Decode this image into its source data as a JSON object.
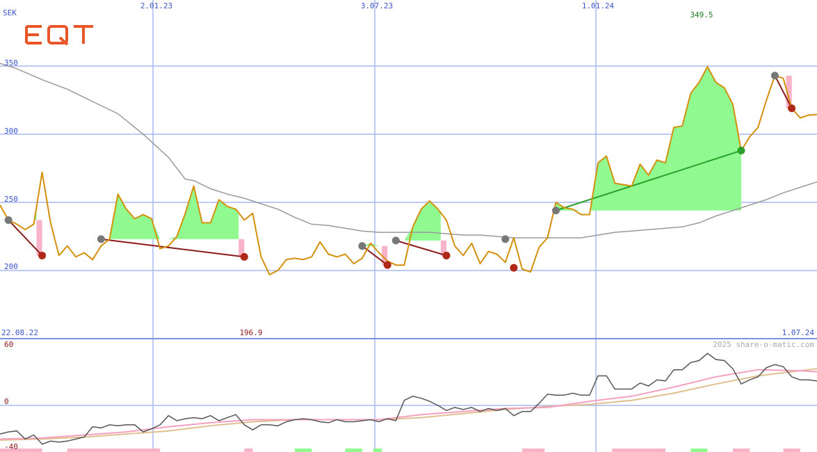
{
  "logo": {
    "text": "EQT",
    "color": "#e8562a"
  },
  "currency": "SEK",
  "watermark": "2025 share-o-matic.com",
  "colors": {
    "price": "#d4900a",
    "sma": "#999999",
    "gain_fill": "#90fa90",
    "loss_fill": "#f9b3c8",
    "gridline": "#a8b8f0",
    "axis_line": "#8090e0",
    "peak_marker": "#777777",
    "trough_marker": "#b02818",
    "trend_down": "#8b1a1a",
    "trend_up": "#2aa02a",
    "osc_main": "#555555",
    "osc_pink": "#f4a0c0",
    "osc_tan": "#e0c090"
  },
  "chart_data": [
    {
      "type": "line",
      "name": "price-panel",
      "unit": "SEK",
      "ylim": [
        165,
        360
      ],
      "yticks": [
        "350",
        "300",
        "250",
        "200"
      ],
      "x_start_label": "22.08.22",
      "x_end_label": "1.07.24",
      "top_date_labels": [
        "2.01.23",
        "3.07.23",
        "1.01.24"
      ],
      "high_label": "349.5",
      "low_label": "196.9",
      "price": [
        [
          0,
          248
        ],
        [
          3,
          237
        ],
        [
          6,
          234
        ],
        [
          9,
          230
        ],
        [
          12,
          234
        ],
        [
          15,
          272
        ],
        [
          18,
          235
        ],
        [
          21,
          211
        ],
        [
          24,
          218
        ],
        [
          27,
          210
        ],
        [
          30,
          213
        ],
        [
          33,
          208
        ],
        [
          36,
          218
        ],
        [
          39,
          223
        ],
        [
          42,
          256
        ],
        [
          45,
          245
        ],
        [
          48,
          238
        ],
        [
          51,
          241
        ],
        [
          54,
          238
        ],
        [
          57,
          216
        ],
        [
          60,
          218
        ],
        [
          63,
          225
        ],
        [
          66,
          242
        ],
        [
          69,
          262
        ],
        [
          72,
          235
        ],
        [
          75,
          235
        ],
        [
          78,
          252
        ],
        [
          81,
          247
        ],
        [
          84,
          245
        ],
        [
          87,
          237
        ],
        [
          90,
          242
        ],
        [
          93,
          210
        ],
        [
          96,
          197
        ],
        [
          99,
          200
        ],
        [
          102,
          208
        ],
        [
          105,
          209
        ],
        [
          108,
          208
        ],
        [
          111,
          210
        ],
        [
          114,
          221
        ],
        [
          117,
          212
        ],
        [
          120,
          210
        ],
        [
          123,
          212
        ],
        [
          126,
          205
        ],
        [
          129,
          209
        ],
        [
          132,
          220
        ],
        [
          135,
          213
        ],
        [
          138,
          207
        ],
        [
          141,
          204
        ],
        [
          144,
          204
        ],
        [
          147,
          232
        ],
        [
          150,
          245
        ],
        [
          153,
          251
        ],
        [
          156,
          245
        ],
        [
          159,
          237
        ],
        [
          162,
          218
        ],
        [
          165,
          211
        ],
        [
          168,
          220
        ],
        [
          171,
          205
        ],
        [
          174,
          214
        ],
        [
          177,
          212
        ],
        [
          180,
          206
        ],
        [
          183,
          224
        ],
        [
          186,
          201
        ],
        [
          189,
          199
        ],
        [
          192,
          217
        ],
        [
          195,
          224
        ],
        [
          198,
          250
        ],
        [
          201,
          246
        ],
        [
          204,
          245
        ],
        [
          207,
          241
        ],
        [
          210,
          241
        ],
        [
          213,
          279
        ],
        [
          216,
          284
        ],
        [
          219,
          264
        ],
        [
          222,
          263
        ],
        [
          225,
          262
        ],
        [
          228,
          278
        ],
        [
          231,
          270
        ],
        [
          234,
          281
        ],
        [
          237,
          279
        ],
        [
          240,
          305
        ],
        [
          243,
          306
        ],
        [
          246,
          330
        ],
        [
          249,
          338
        ],
        [
          252,
          349.5
        ],
        [
          255,
          338
        ],
        [
          258,
          334
        ],
        [
          261,
          322
        ],
        [
          264,
          288
        ],
        [
          267,
          298
        ],
        [
          270,
          305
        ],
        [
          273,
          325
        ],
        [
          276,
          343
        ],
        [
          279,
          341
        ],
        [
          282,
          319
        ],
        [
          285,
          312
        ],
        [
          288,
          314
        ],
        [
          291,
          314.5
        ]
      ],
      "sma": [
        [
          0,
          352
        ],
        [
          6,
          348
        ],
        [
          15,
          340
        ],
        [
          24,
          333
        ],
        [
          33,
          324
        ],
        [
          42,
          315
        ],
        [
          51,
          300
        ],
        [
          60,
          283
        ],
        [
          66,
          267
        ],
        [
          69,
          266
        ],
        [
          75,
          260
        ],
        [
          81,
          256
        ],
        [
          87,
          253
        ],
        [
          93,
          249
        ],
        [
          99,
          245
        ],
        [
          105,
          239
        ],
        [
          111,
          234
        ],
        [
          117,
          233
        ],
        [
          123,
          231
        ],
        [
          129,
          229
        ],
        [
          135,
          228
        ],
        [
          141,
          228
        ],
        [
          147,
          228
        ],
        [
          153,
          228
        ],
        [
          159,
          227
        ],
        [
          165,
          226
        ],
        [
          171,
          226
        ],
        [
          177,
          225
        ],
        [
          183,
          224
        ],
        [
          189,
          224
        ],
        [
          195,
          224
        ],
        [
          201,
          224
        ],
        [
          207,
          224
        ],
        [
          213,
          226
        ],
        [
          219,
          228
        ],
        [
          225,
          229
        ],
        [
          231,
          230
        ],
        [
          237,
          231
        ],
        [
          243,
          232
        ],
        [
          249,
          235
        ],
        [
          255,
          240
        ],
        [
          261,
          244
        ],
        [
          267,
          248
        ],
        [
          273,
          252
        ],
        [
          279,
          257
        ],
        [
          285,
          261
        ],
        [
          291,
          265
        ]
      ],
      "peaks": [
        [
          3,
          237
        ],
        [
          36,
          223
        ],
        [
          129,
          218
        ],
        [
          141,
          222
        ],
        [
          180,
          223
        ],
        [
          198,
          244
        ],
        [
          276,
          343
        ]
      ],
      "troughs": [
        [
          15,
          211
        ],
        [
          87,
          210
        ],
        [
          138,
          204
        ],
        [
          159,
          211
        ],
        [
          183,
          202
        ],
        [
          282,
          319
        ]
      ],
      "gain_marker": [
        [
          264,
          288
        ]
      ],
      "trend_lines": [
        {
          "dir": "down",
          "from": [
            3,
            237
          ],
          "to": [
            15,
            211
          ]
        },
        {
          "dir": "down",
          "from": [
            36,
            223
          ],
          "to": [
            87,
            210
          ]
        },
        {
          "dir": "down",
          "from": [
            129,
            218
          ],
          "to": [
            138,
            204
          ]
        },
        {
          "dir": "down",
          "from": [
            141,
            222
          ],
          "to": [
            159,
            211
          ]
        },
        {
          "dir": "up",
          "from": [
            198,
            244
          ],
          "to": [
            264,
            288
          ]
        },
        {
          "dir": "down",
          "from": [
            276,
            343
          ],
          "to": [
            282,
            319
          ]
        }
      ]
    },
    {
      "type": "line",
      "name": "oscillator-panel",
      "ylim": [
        -40,
        60
      ],
      "yticks": [
        "60",
        "0",
        "-40"
      ],
      "main": [
        [
          0,
          -28
        ],
        [
          3,
          -26
        ],
        [
          6,
          -25
        ],
        [
          9,
          -33
        ],
        [
          12,
          -29
        ],
        [
          15,
          -38
        ],
        [
          18,
          -35
        ],
        [
          21,
          -36
        ],
        [
          24,
          -35
        ],
        [
          27,
          -33
        ],
        [
          30,
          -31
        ],
        [
          33,
          -21
        ],
        [
          36,
          -22
        ],
        [
          39,
          -19
        ],
        [
          42,
          -20
        ],
        [
          45,
          -19
        ],
        [
          48,
          -19
        ],
        [
          51,
          -26
        ],
        [
          54,
          -23
        ],
        [
          57,
          -19
        ],
        [
          60,
          -10
        ],
        [
          63,
          -15
        ],
        [
          66,
          -13
        ],
        [
          69,
          -12
        ],
        [
          72,
          -13
        ],
        [
          75,
          -10
        ],
        [
          78,
          -15
        ],
        [
          81,
          -12
        ],
        [
          84,
          -9
        ],
        [
          87,
          -19
        ],
        [
          90,
          -24
        ],
        [
          93,
          -19
        ],
        [
          96,
          -19
        ],
        [
          99,
          -20
        ],
        [
          102,
          -16
        ],
        [
          105,
          -14
        ],
        [
          108,
          -13
        ],
        [
          111,
          -14
        ],
        [
          114,
          -16
        ],
        [
          117,
          -17
        ],
        [
          120,
          -14
        ],
        [
          123,
          -16
        ],
        [
          126,
          -16
        ],
        [
          129,
          -15
        ],
        [
          132,
          -14
        ],
        [
          135,
          -16
        ],
        [
          138,
          -13
        ],
        [
          141,
          -15
        ],
        [
          144,
          5
        ],
        [
          147,
          9
        ],
        [
          150,
          7
        ],
        [
          153,
          4
        ],
        [
          156,
          0
        ],
        [
          159,
          -5
        ],
        [
          162,
          -2
        ],
        [
          165,
          -4
        ],
        [
          168,
          -2
        ],
        [
          171,
          -6
        ],
        [
          174,
          -3
        ],
        [
          177,
          -5
        ],
        [
          180,
          -3
        ],
        [
          183,
          -10
        ],
        [
          186,
          -6
        ],
        [
          189,
          -6
        ],
        [
          192,
          2
        ],
        [
          195,
          11
        ],
        [
          198,
          10
        ],
        [
          201,
          10
        ],
        [
          204,
          12
        ],
        [
          207,
          10
        ],
        [
          210,
          10
        ],
        [
          213,
          29
        ],
        [
          216,
          29
        ],
        [
          219,
          16
        ],
        [
          222,
          16
        ],
        [
          225,
          16
        ],
        [
          228,
          22
        ],
        [
          231,
          19
        ],
        [
          234,
          25
        ],
        [
          237,
          24
        ],
        [
          240,
          35
        ],
        [
          243,
          35
        ],
        [
          246,
          42
        ],
        [
          249,
          44
        ],
        [
          252,
          51
        ],
        [
          255,
          45
        ],
        [
          258,
          44
        ],
        [
          261,
          36
        ],
        [
          264,
          21
        ],
        [
          267,
          25
        ],
        [
          270,
          28
        ],
        [
          273,
          37
        ],
        [
          276,
          40
        ],
        [
          279,
          38
        ],
        [
          282,
          28
        ],
        [
          285,
          25
        ],
        [
          288,
          25
        ],
        [
          291,
          24
        ]
      ],
      "signal_pink": [
        [
          0,
          -33
        ],
        [
          15,
          -32
        ],
        [
          30,
          -29
        ],
        [
          45,
          -26
        ],
        [
          60,
          -21
        ],
        [
          75,
          -17
        ],
        [
          90,
          -14
        ],
        [
          105,
          -14
        ],
        [
          120,
          -14
        ],
        [
          135,
          -14
        ],
        [
          150,
          -9
        ],
        [
          165,
          -6
        ],
        [
          180,
          -3
        ],
        [
          195,
          -2
        ],
        [
          210,
          4
        ],
        [
          225,
          9
        ],
        [
          240,
          18
        ],
        [
          255,
          28
        ],
        [
          270,
          35
        ],
        [
          285,
          34
        ],
        [
          291,
          33
        ]
      ],
      "signal_tan": [
        [
          0,
          -34
        ],
        [
          15,
          -33
        ],
        [
          30,
          -31
        ],
        [
          45,
          -28
        ],
        [
          60,
          -25
        ],
        [
          75,
          -20
        ],
        [
          90,
          -16
        ],
        [
          105,
          -14
        ],
        [
          120,
          -14
        ],
        [
          135,
          -14
        ],
        [
          150,
          -12
        ],
        [
          165,
          -8
        ],
        [
          180,
          -4
        ],
        [
          195,
          -1
        ],
        [
          210,
          1
        ],
        [
          225,
          5
        ],
        [
          240,
          12
        ],
        [
          255,
          21
        ],
        [
          270,
          29
        ],
        [
          285,
          34
        ],
        [
          291,
          36
        ]
      ],
      "volume_bars": [
        {
          "x0": 0,
          "x1": 15,
          "c": "loss"
        },
        {
          "x0": 24,
          "x1": 57,
          "c": "loss"
        },
        {
          "x0": 87,
          "x1": 90,
          "c": "loss"
        },
        {
          "x0": 105,
          "x1": 111,
          "c": "gain"
        },
        {
          "x0": 123,
          "x1": 129,
          "c": "gain"
        },
        {
          "x0": 133,
          "x1": 136,
          "c": "gain"
        },
        {
          "x0": 186,
          "x1": 194,
          "c": "loss"
        },
        {
          "x0": 218,
          "x1": 237,
          "c": "loss"
        },
        {
          "x0": 246,
          "x1": 252,
          "c": "gain"
        },
        {
          "x0": 261,
          "x1": 267,
          "c": "loss"
        },
        {
          "x0": 279,
          "x1": 285,
          "c": "loss"
        }
      ]
    }
  ]
}
